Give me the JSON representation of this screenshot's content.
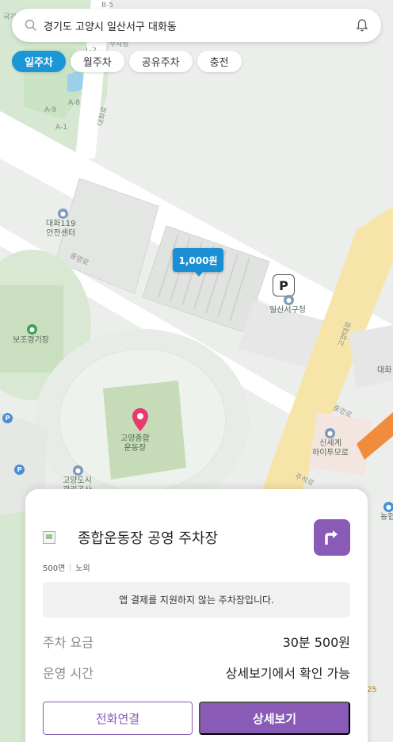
{
  "search": {
    "address": "경기도 고양시 일산서구 대화동"
  },
  "filters": [
    {
      "label": "일주차",
      "active": true
    },
    {
      "label": "월주차",
      "active": false
    },
    {
      "label": "공유주차",
      "active": false
    },
    {
      "label": "충전",
      "active": false
    }
  ],
  "map": {
    "price_marker": "1,000원",
    "parking_marker": "P",
    "labels": {
      "fire_station": "대화119\n안전센터",
      "district_office": "일산서구청",
      "aux_stadium": "보조경기장",
      "stadium": "고양종합\n운동장",
      "shinsegae": "신세계\n하이투모로",
      "library": "고양도시\n관리공사",
      "daehwa": "대화",
      "nonghyup": "농협",
      "b5": "B-5",
      "l2": "L-2",
      "a9": "A-9",
      "a8": "A-8",
      "a1": "A-1",
      "geog": "국기",
      "parking_top": "주차장",
      "num25": "25"
    },
    "roads": {
      "jungang_1": "중앙로",
      "jungang_2": "중앙로",
      "daehwa_ro": "대화로",
      "goyang_daero": "고양대로",
      "jusang_ro": "주석로"
    }
  },
  "sheet": {
    "lot_name": "종합운동장 공영 주차장",
    "spaces": "500면",
    "type": "노외",
    "notice": "앱 결제를 지원하지 않는 주차장입니다.",
    "fee_label": "주차 요금",
    "fee_value": "30분 500원",
    "hours_label": "운영 시간",
    "hours_value": "상세보기에서 확인 가능",
    "call_button": "전화연결",
    "detail_button": "상세보기"
  },
  "colors": {
    "accent_blue": "#1b97d8",
    "accent_purple": "#8a5bb6"
  }
}
